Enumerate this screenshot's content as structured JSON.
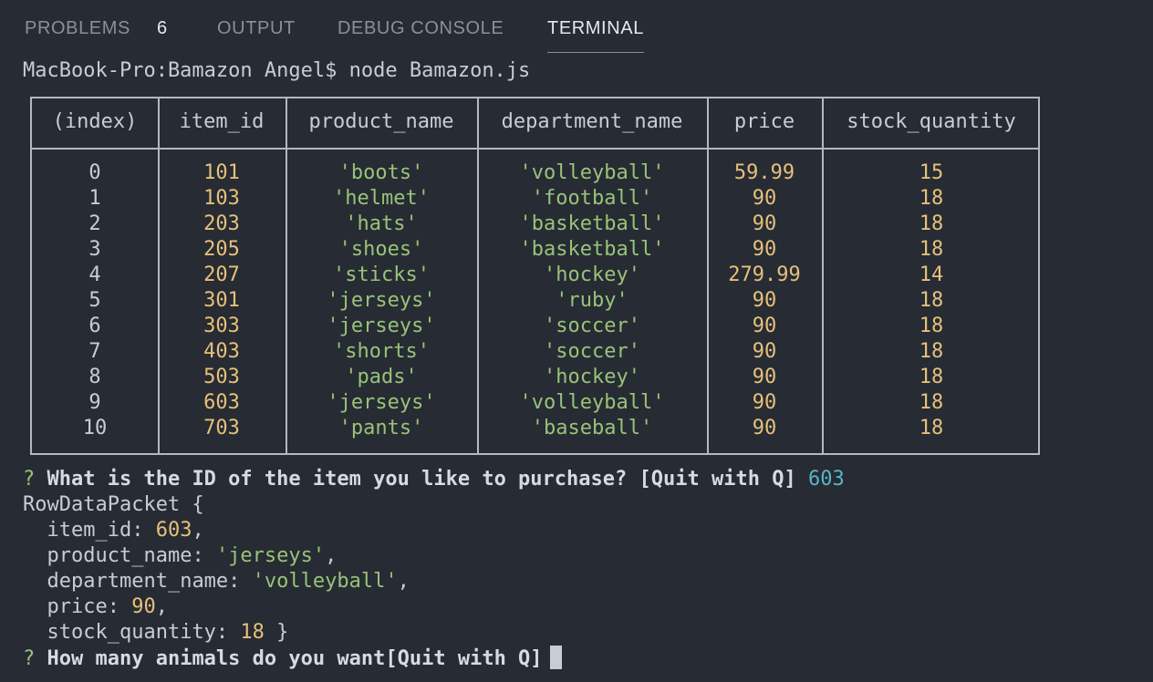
{
  "tabs": {
    "problems": "PROBLEMS",
    "problems_count": "6",
    "output": "OUTPUT",
    "debug_console": "DEBUG CONSOLE",
    "terminal": "TERMINAL"
  },
  "terminal": {
    "prompt_line": "MacBook-Pro:Bamazon Angel$ node Bamazon.js",
    "table": {
      "headers": [
        "(index)",
        "item_id",
        "product_name",
        "department_name",
        "price",
        "stock_quantity"
      ],
      "rows": [
        [
          "0",
          "101",
          "'boots'",
          "'volleyball'",
          "59.99",
          "15"
        ],
        [
          "1",
          "103",
          "'helmet'",
          "'football'",
          "90",
          "18"
        ],
        [
          "2",
          "203",
          "'hats'",
          "'basketball'",
          "90",
          "18"
        ],
        [
          "3",
          "205",
          "'shoes'",
          "'basketball'",
          "90",
          "18"
        ],
        [
          "4",
          "207",
          "'sticks'",
          "'hockey'",
          "279.99",
          "14"
        ],
        [
          "5",
          "301",
          "'jerseys'",
          "'ruby'",
          "90",
          "18"
        ],
        [
          "6",
          "303",
          "'jerseys'",
          "'soccer'",
          "90",
          "18"
        ],
        [
          "7",
          "403",
          "'shorts'",
          "'soccer'",
          "90",
          "18"
        ],
        [
          "8",
          "503",
          "'pads'",
          "'hockey'",
          "90",
          "18"
        ],
        [
          "9",
          "603",
          "'jerseys'",
          "'volleyball'",
          "90",
          "18"
        ],
        [
          "10",
          "703",
          "'pants'",
          "'baseball'",
          "90",
          "18"
        ]
      ]
    },
    "question1": {
      "mark": "?",
      "text": "What is the ID of the item you like to purchase? [Quit with Q]",
      "answer": "603"
    },
    "packet": {
      "open": "RowDataPacket {",
      "item_id_key": "item_id: ",
      "item_id_val": "603",
      "product_name_key": "product_name: ",
      "product_name_val": "'jerseys'",
      "department_name_key": "department_name: ",
      "department_name_val": "'volleyball'",
      "price_key": "price: ",
      "price_val": "90",
      "stock_quantity_key": "stock_quantity: ",
      "stock_quantity_val": "18",
      "comma": ",",
      "close": " }"
    },
    "question2": {
      "mark": "?",
      "text": "How many animals do you want[Quit with Q]"
    }
  },
  "colors": {
    "background": "#272b33",
    "number": "#e5c07b",
    "string": "#98c379",
    "answer": "#56b6c2"
  }
}
